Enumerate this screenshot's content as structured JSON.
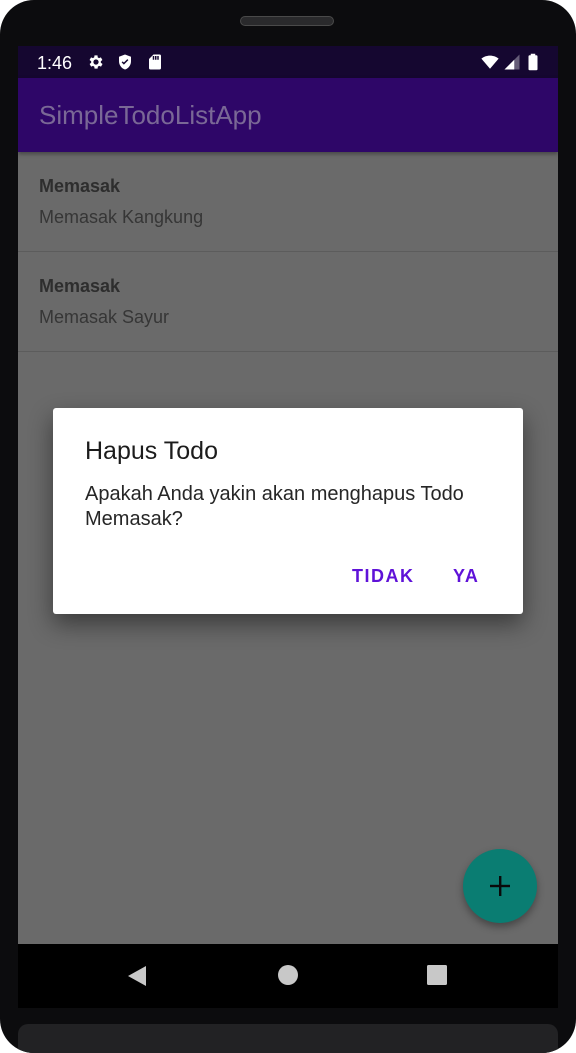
{
  "status_bar": {
    "time": "1:46",
    "left_icons": [
      "gear-icon",
      "shield-icon",
      "sd-card-icon"
    ],
    "right_icons": [
      "wifi-icon",
      "signal-icon",
      "battery-icon"
    ]
  },
  "app_bar": {
    "title": "SimpleTodoListApp"
  },
  "todos": [
    {
      "title": "Memasak",
      "description": "Memasak Kangkung"
    },
    {
      "title": "Memasak",
      "description": "Memasak Sayur"
    }
  ],
  "dialog": {
    "title": "Hapus Todo",
    "message": "Apakah Anda yakin akan menghapus Todo Memasak?",
    "negative_button": "TIDAK",
    "positive_button": "YA"
  },
  "fab": {
    "icon": "plus-icon"
  },
  "nav_bar": {
    "icons": [
      "back-icon",
      "home-icon",
      "recents-icon"
    ]
  },
  "colors": {
    "status_bar": "#150730",
    "app_bar": "#2e0668",
    "accent": "#5f12d8",
    "fab": "#0a7d72",
    "scrim": "#6a6a6a"
  }
}
